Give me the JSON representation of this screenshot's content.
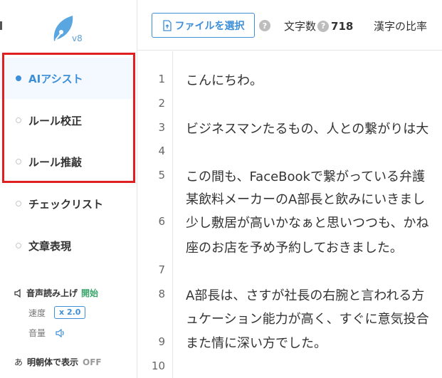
{
  "logo": {
    "version": "v8"
  },
  "sidebar": {
    "items": [
      {
        "label": "AIアシスト",
        "active": true
      },
      {
        "label": "ルール校正",
        "active": false
      },
      {
        "label": "ルール推敲",
        "active": false
      },
      {
        "label": "チェックリスト",
        "active": false
      },
      {
        "label": "文章表現",
        "active": false
      }
    ],
    "tts": {
      "label": "音声読み上げ",
      "start": "開始"
    },
    "speed": {
      "label": "速度",
      "value": "x 2.0"
    },
    "volume": {
      "label": "音量"
    },
    "mincho": {
      "glyph": "あ",
      "label": "明朝体で表示",
      "state": "OFF"
    }
  },
  "toolbar": {
    "file_button": "ファイルを選択",
    "help": "?",
    "char_count_label": "文字数",
    "char_count_value": "718",
    "kanji_ratio_label": "漢字の比率"
  },
  "editor": {
    "line_numbers": [
      "1",
      "2",
      "3",
      "4",
      "5",
      "6",
      "7",
      "8",
      "9",
      "10"
    ],
    "lines": [
      "こんにちわ。",
      "ビジネスマンたるもの、人との繋がりは大",
      "この間も、FaceBookで繋がっている弁護",
      "某飲料メーカーのA部長と飲みにいきまし",
      "少し敷居が高いかなぁと思いつつも、かね",
      "座のお店を予め予約しておきました。",
      "A部長は、さすが社長の右腕と言われる方",
      "ュケーション能力が高く、すぐに意気投合",
      "また情に深い方でした。"
    ]
  },
  "colors": {
    "accent": "#3d8fd8",
    "start_green": "#3aa56b",
    "highlight_red": "#e02020"
  }
}
